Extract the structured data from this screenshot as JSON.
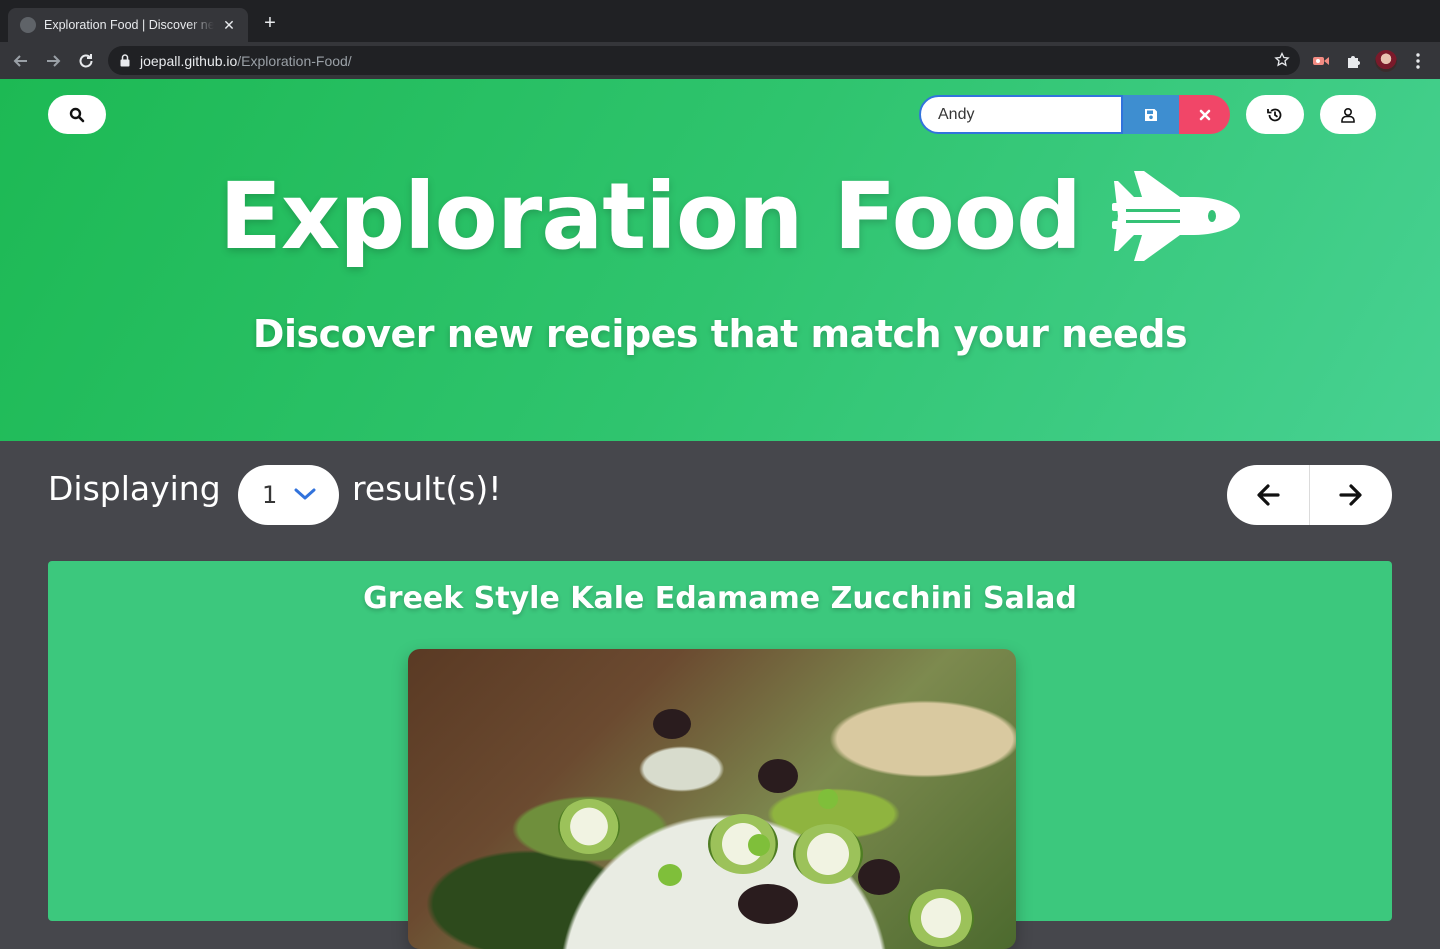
{
  "browser": {
    "tab_title": "Exploration Food | Discover new recipes that match your needs",
    "url_host": "joepall.github.io",
    "url_path": "/Exploration-Food/"
  },
  "header": {
    "name_input_value": "Andy",
    "icons": [
      "search-icon",
      "save-icon",
      "close-icon",
      "history-icon",
      "user-icon",
      "space-shuttle-icon"
    ]
  },
  "hero": {
    "title": "Exploration Food",
    "subtitle": "Discover new recipes that match your needs"
  },
  "results": {
    "prefix": "Displaying",
    "count": "1",
    "suffix": "result(s)!"
  },
  "recipe": {
    "title": "Greek Style Kale Edamame Zucchini Salad"
  },
  "colors": {
    "hero_start": "#1db954",
    "hero_end": "#47d192",
    "card": "#3cc87d",
    "page_bg": "#46474c",
    "save": "#3e8ed0",
    "clear": "#f14668"
  }
}
